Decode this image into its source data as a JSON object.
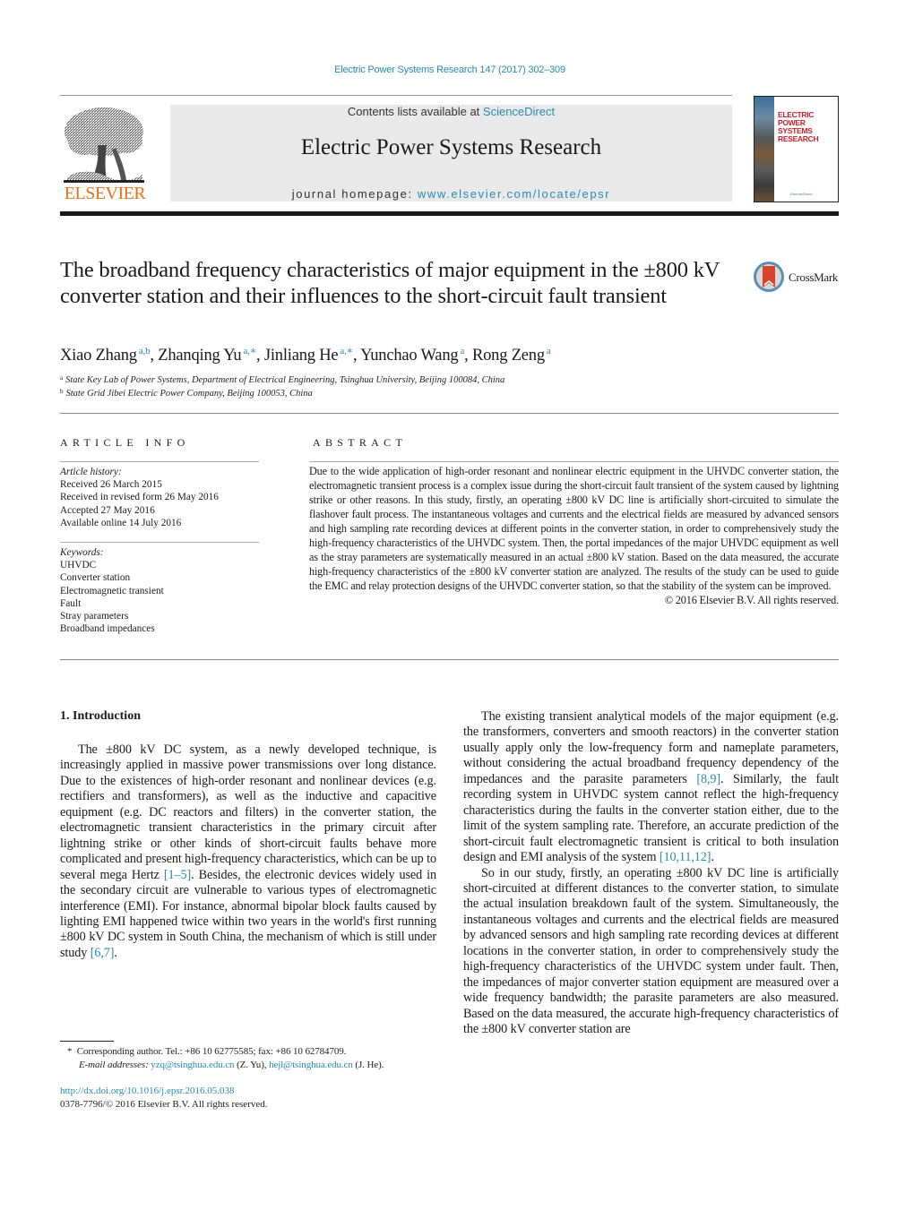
{
  "header": {
    "running_head": "Electric Power Systems Research 147 (2017) 302–309",
    "publisher_logo_text": "ELSEVIER",
    "contents_prefix": "Contents lists available at ",
    "contents_link": "ScienceDirect",
    "journal_title": "Electric Power Systems Research",
    "homepage_prefix": "journal homepage: ",
    "homepage_link": "www.elsevier.com/locate/epsr",
    "cover_title_line1": "ELECTRIC POWER",
    "cover_title_line2": "SYSTEMS RESEARCH",
    "cover_publisher": "ElsevierDirect"
  },
  "article": {
    "title": "The broadband frequency characteristics of major equipment in the ±800 kV converter station and their influences to the short-circuit fault transient",
    "crossmark_label": "CrossMark",
    "authors": [
      {
        "name": "Xiao Zhang",
        "sup": "a,b",
        "sep": ", "
      },
      {
        "name": "Zhanqing Yu",
        "sup": "a,∗",
        "sep": ", "
      },
      {
        "name": "Jinliang He",
        "sup": "a,∗",
        "sep": ", "
      },
      {
        "name": "Yunchao Wang",
        "sup": "a",
        "sep": ", "
      },
      {
        "name": "Rong Zeng",
        "sup": "a",
        "sep": ""
      }
    ],
    "affiliations": [
      {
        "mark": "a",
        "text": "State Key Lab of Power Systems, Department of Electrical Engineering, Tsinghua University, Beijing 100084, China"
      },
      {
        "mark": "b",
        "text": "State Grid Jibei Electric Power Company, Beijing 100053, China"
      }
    ]
  },
  "article_info": {
    "heading": "ARTICLE INFO",
    "history_label": "Article history:",
    "history": [
      "Received 26 March 2015",
      "Received in revised form 26 May 2016",
      "Accepted 27 May 2016",
      "Available online 14 July 2016"
    ],
    "keywords_label": "Keywords:",
    "keywords": [
      "UHVDC",
      "Converter station",
      "Electromagnetic transient",
      "Fault",
      "Stray parameters",
      "Broadband impedances"
    ]
  },
  "abstract": {
    "heading": "ABSTRACT",
    "text": "Due to the wide application of high-order resonant and nonlinear electric equipment in the UHVDC converter station, the electromagnetic transient process is a complex issue during the short-circuit fault transient of the system caused by lightning strike or other reasons. In this study, firstly, an operating ±800 kV DC line is artificially short-circuited to simulate the flashover fault process. The instantaneous voltages and currents and the electrical fields are measured by advanced sensors and high sampling rate recording devices at different points in the converter station, in order to comprehensively study the high-frequency characteristics of the UHVDC system. Then, the portal impedances of the major UHVDC equipment as well as the stray parameters are systematically measured in an actual ±800 kV station. Based on the data measured, the accurate high-frequency characteristics of the ±800 kV converter station are analyzed. The results of the study can be used to guide the EMC and relay protection designs of the UHVDC converter station, so that the stability of the system can be improved.",
    "copyright": "© 2016 Elsevier B.V. All rights reserved."
  },
  "body": {
    "section_heading": "1.  Introduction",
    "left_para": {
      "t1": "The ±800 kV DC system, as a newly developed technique, is increasingly applied in massive power transmissions over long distance. Due to the existences of high-order resonant and nonlinear devices (e.g. rectifiers and transformers), as well as the inductive and capacitive equipment (e.g. DC reactors and filters) in the converter station, the electromagnetic transient characteristics in the primary circuit after lightning strike or other kinds of short-circuit faults behave more complicated and present high-frequency characteristics, which can be up to several mega Hertz ",
      "ref1": "[1–5]",
      "t2": ". Besides, the electronic devices widely used in the secondary circuit are vulnerable to various types of electromagnetic interference (EMI). For instance, abnormal bipolar block faults caused by lighting EMI happened twice within two years in the world's first running ±800 kV DC system in South China, the mechanism of which is still under study ",
      "ref2": "[6,7]",
      "t3": "."
    },
    "right_para1": {
      "t1": "The existing transient analytical models of the major equipment (e.g. the transformers, converters and smooth reactors) in the converter station usually apply only the low-frequency form and nameplate parameters, without considering the actual broadband frequency dependency of the impedances and the parasite parameters ",
      "ref1": "[8,9]",
      "t2": ". Similarly, the fault recording system in UHVDC system cannot reflect the high-frequency characteristics during the faults in the converter station either, due to the limit of the system sampling rate. Therefore, an accurate prediction of the short-circuit fault electromagnetic transient is critical to both insulation design and EMI analysis of the system ",
      "ref2": "[10,11,12]",
      "t3": "."
    },
    "right_para2": "So in our study, firstly, an operating ±800 kV DC line is artificially short-circuited at different distances to the converter station, to simulate the actual insulation breakdown fault of the system. Simultaneously, the instantaneous voltages and currents and the electrical fields are measured by advanced sensors and high sampling rate recording devices at different locations in the converter station, in order to comprehensively study the high-frequency characteristics of the UHVDC system under fault. Then, the impedances of major converter station equipment are measured over a wide frequency bandwidth; the parasite parameters are also measured. Based on the data measured, the accurate high-frequency characteristics of the ±800 kV converter station are"
  },
  "footer": {
    "corresponding_mark": "*",
    "corresponding": "Corresponding author. Tel.: +86 10 62775585; fax: +86 10 62784709.",
    "email_label": "E-mail addresses:",
    "email1": "yzq@tsinghua.edu.cn",
    "email1_owner": " (Z. Yu), ",
    "email2": "hejl@tsinghua.edu.cn",
    "email2_owner": " (J. He).",
    "doi": "http://dx.doi.org/10.1016/j.epsr.2016.05.038",
    "issn": "0378-7796/© 2016 Elsevier B.V. All rights reserved."
  },
  "colors": {
    "link": "#2a8ab0",
    "elsevier_orange": "#e9711c",
    "banner_bg": "#e9e9e9",
    "cover_title_red": "#c8202a"
  }
}
